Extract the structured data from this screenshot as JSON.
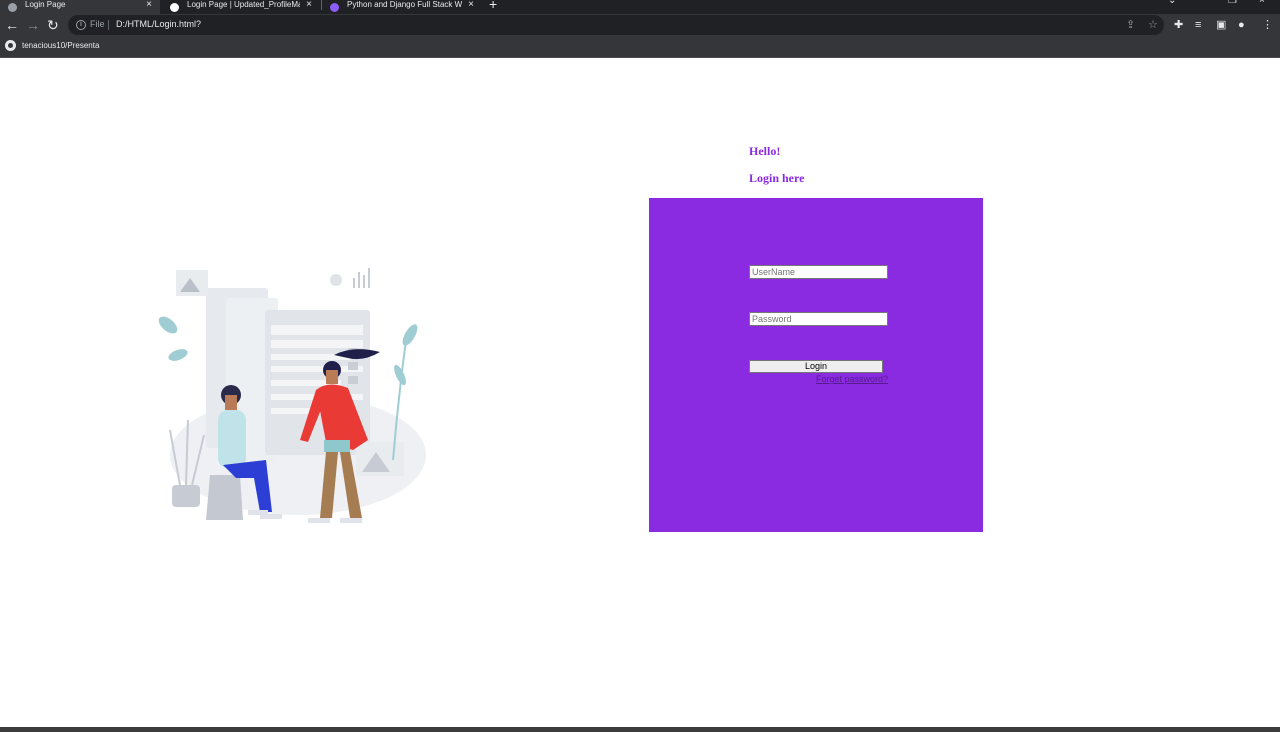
{
  "browser": {
    "tabs": [
      {
        "title": "Login Page",
        "active": true,
        "favicon_color": "#9aa0a6"
      },
      {
        "title": "Login Page | Updated_ProfileMa",
        "active": false,
        "favicon_color": "#ffffff"
      },
      {
        "title": "Python and Django Full Stack W",
        "active": false,
        "favicon_color": "#8b5cf6"
      }
    ],
    "new_tab": "+",
    "nav": {
      "back": "←",
      "forward": "→",
      "reload": "↻"
    },
    "address": {
      "file_label": "File",
      "url": "D:/HTML/Login.html?"
    },
    "bookmarks": [
      {
        "label": "tenacious10/Presenta",
        "icon": "github-icon"
      }
    ]
  },
  "page": {
    "greeting": "Hello!",
    "subtitle": "Login here",
    "form": {
      "username_placeholder": "UserName",
      "password_placeholder": "Password",
      "login_label": "Login",
      "forgot_label": "Forget password?"
    },
    "colors": {
      "accent": "#8a2be2",
      "link": "#551a8b"
    }
  }
}
